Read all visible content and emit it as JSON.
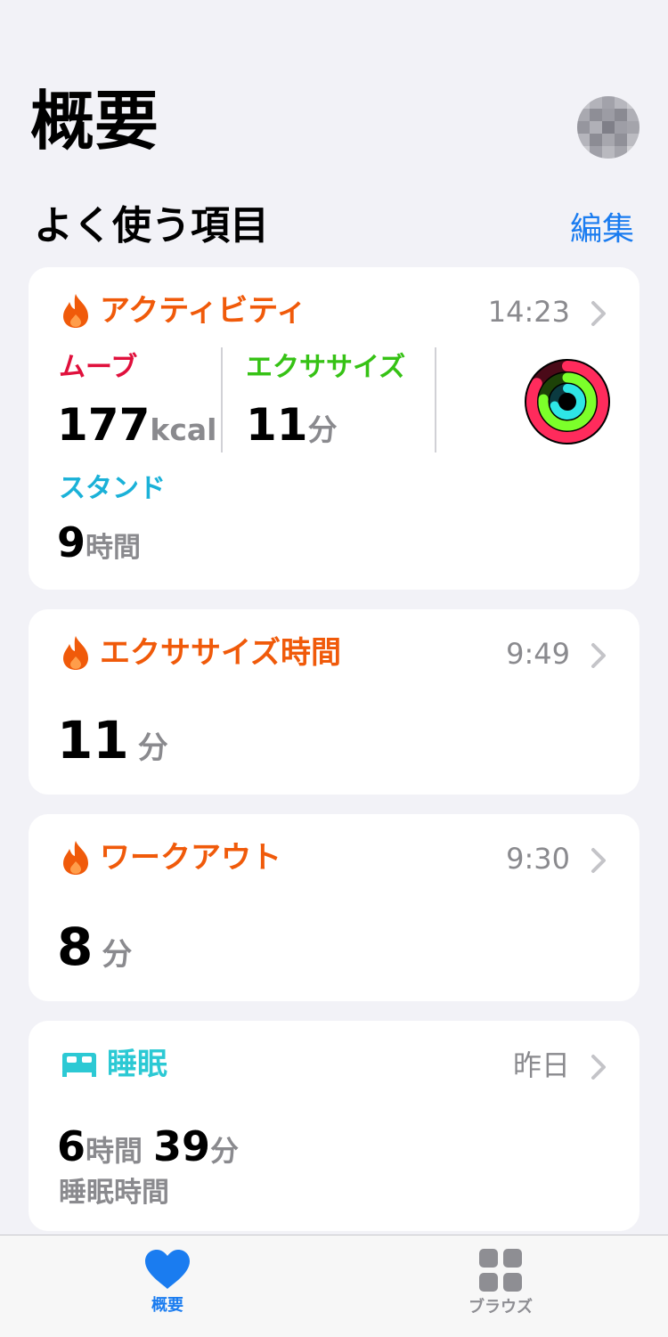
{
  "header": {
    "title": "概要"
  },
  "favorites": {
    "title": "よく使う項目",
    "edit": "編集"
  },
  "activity": {
    "title": "アクティビティ",
    "time": "14:23",
    "move": {
      "label": "ムーブ",
      "value": "177",
      "unit": "kcal"
    },
    "exercise": {
      "label": "エクササイズ",
      "value": "11",
      "unit": "分"
    },
    "stand": {
      "label": "スタンド",
      "value": "9",
      "unit": "時間"
    },
    "colors": {
      "move": "#e0103c",
      "exercise": "#36c215",
      "stand": "#1ab1d8"
    }
  },
  "exercise_time": {
    "title": "エクササイズ時間",
    "time": "9:49",
    "value": "11",
    "unit": "分"
  },
  "workout": {
    "title": "ワークアウト",
    "time": "9:30",
    "value": "8",
    "unit": "分"
  },
  "sleep": {
    "title": "睡眠",
    "time": "昨日",
    "hours": "6",
    "hours_unit": "時間",
    "minutes": "39",
    "minutes_unit": "分",
    "caption": "睡眠時間"
  },
  "tabbar": {
    "summary": "概要",
    "browse": "ブラウズ"
  },
  "colors": {
    "accent": "#1a7cf0",
    "activity": "#f05a0a",
    "sleep": "#2cc9d4"
  },
  "icons": [
    "flame-icon",
    "bed-icon",
    "chevron-right-icon",
    "heart-icon",
    "grid-icon",
    "activity-rings-icon"
  ]
}
